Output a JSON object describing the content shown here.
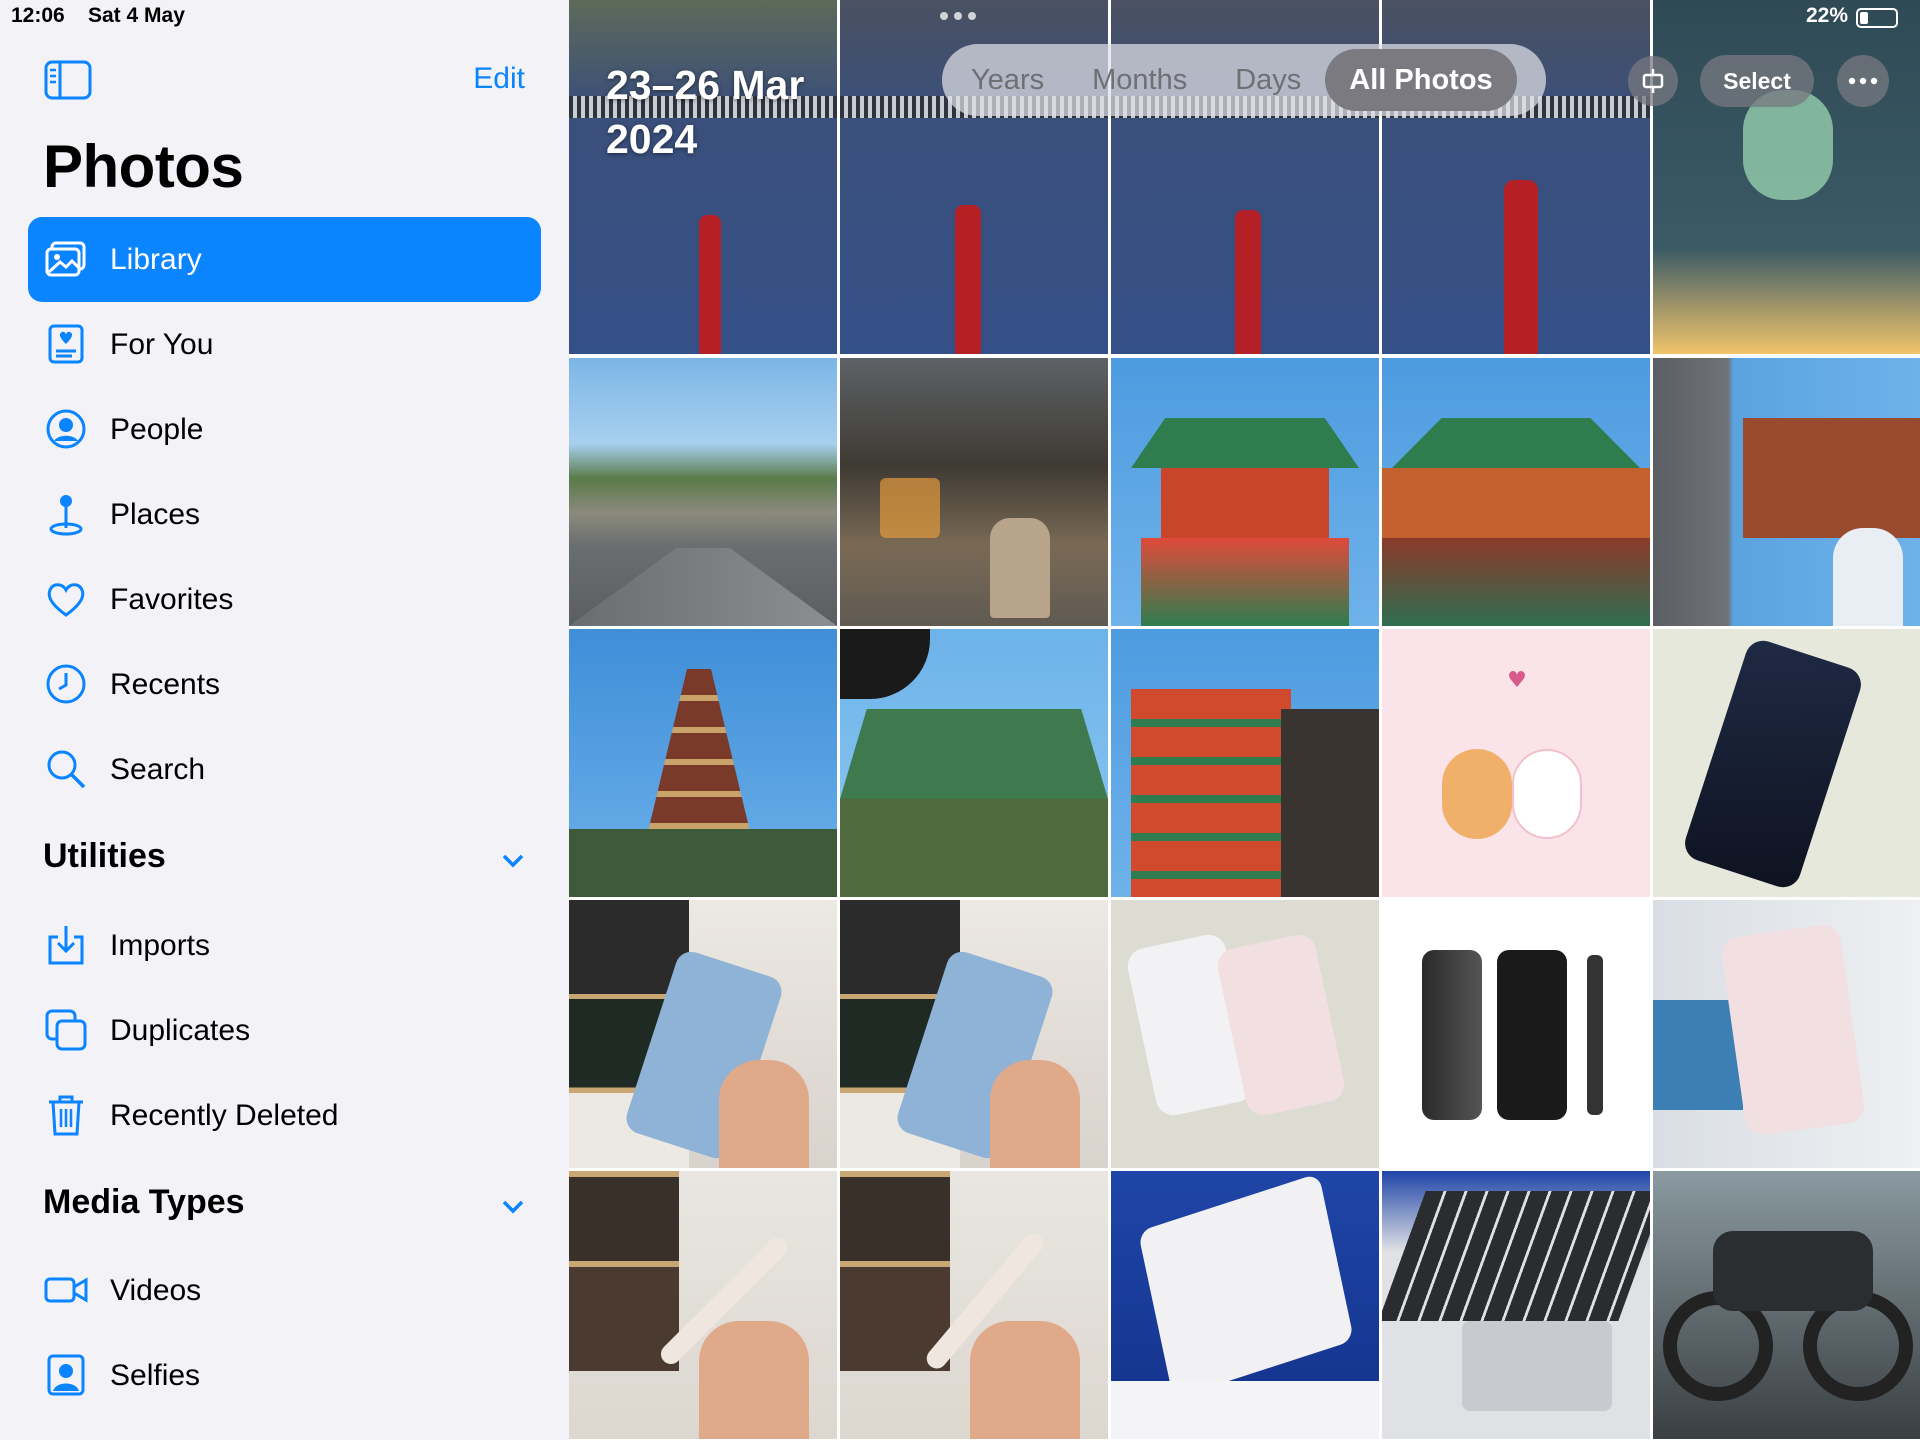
{
  "status": {
    "time": "12:06",
    "date": "Sat 4 May",
    "battery": "22%"
  },
  "sidebar": {
    "edit_label": "Edit",
    "title": "Photos",
    "items": [
      {
        "label": "Library",
        "icon": "library-icon",
        "active": true
      },
      {
        "label": "For You",
        "icon": "for-you-icon"
      },
      {
        "label": "People",
        "icon": "person-icon"
      },
      {
        "label": "Places",
        "icon": "map-pin-icon"
      },
      {
        "label": "Favorites",
        "icon": "heart-icon"
      },
      {
        "label": "Recents",
        "icon": "clock-icon"
      },
      {
        "label": "Search",
        "icon": "search-icon"
      }
    ],
    "utilities": {
      "title": "Utilities",
      "items": [
        {
          "label": "Imports",
          "icon": "import-icon"
        },
        {
          "label": "Duplicates",
          "icon": "duplicates-icon"
        },
        {
          "label": "Recently Deleted",
          "icon": "trash-icon"
        }
      ]
    },
    "media_types": {
      "title": "Media Types",
      "items": [
        {
          "label": "Videos",
          "icon": "video-icon"
        },
        {
          "label": "Selfies",
          "icon": "selfie-icon"
        }
      ]
    }
  },
  "toolbar": {
    "date_line1": "23–26 Mar",
    "date_line2": "2024",
    "segments": [
      "Years",
      "Months",
      "Days",
      "All Photos"
    ],
    "selected_segment": "All Photos",
    "select_label": "Select",
    "accent": "#0a84ff"
  }
}
